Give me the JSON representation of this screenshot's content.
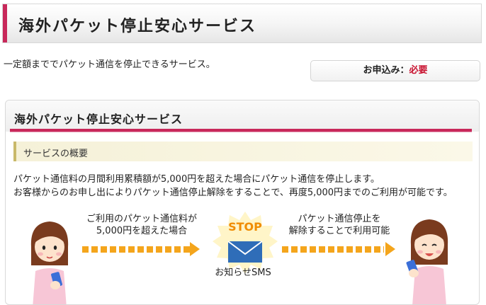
{
  "header": {
    "title": "海外パケット停止安心サービス"
  },
  "intro": {
    "text": "一定額まででパケット通信を停止できるサービス。"
  },
  "apply": {
    "label": "お申込み：",
    "status": "必要"
  },
  "panel": {
    "title": "海外パケット停止安心サービス",
    "section_title": "サービスの概要",
    "desc_line1": "パケット通信料の月間利用累積額が5,000円を超えた場合にパケット通信を停止します。",
    "desc_line2": "お客様からのお申し出によりパケット通信停止解除をすることで、再度5,000円までのご利用が可能です。"
  },
  "flow": {
    "left_line1": "ご利用のパケット通信料が",
    "left_line2": "5,000円を超えた場合",
    "stop": "STOP",
    "sms": "お知らせSMS",
    "right_line1": "パケット通信停止を",
    "right_line2": "解除することで利用可能"
  },
  "colors": {
    "accent": "#c8285a",
    "required": "#c8102e",
    "arrow": "#f4a51c",
    "stop": "#f08c00"
  },
  "icons": [
    "person-with-phone-icon",
    "stop-badge-icon",
    "envelope-icon"
  ]
}
